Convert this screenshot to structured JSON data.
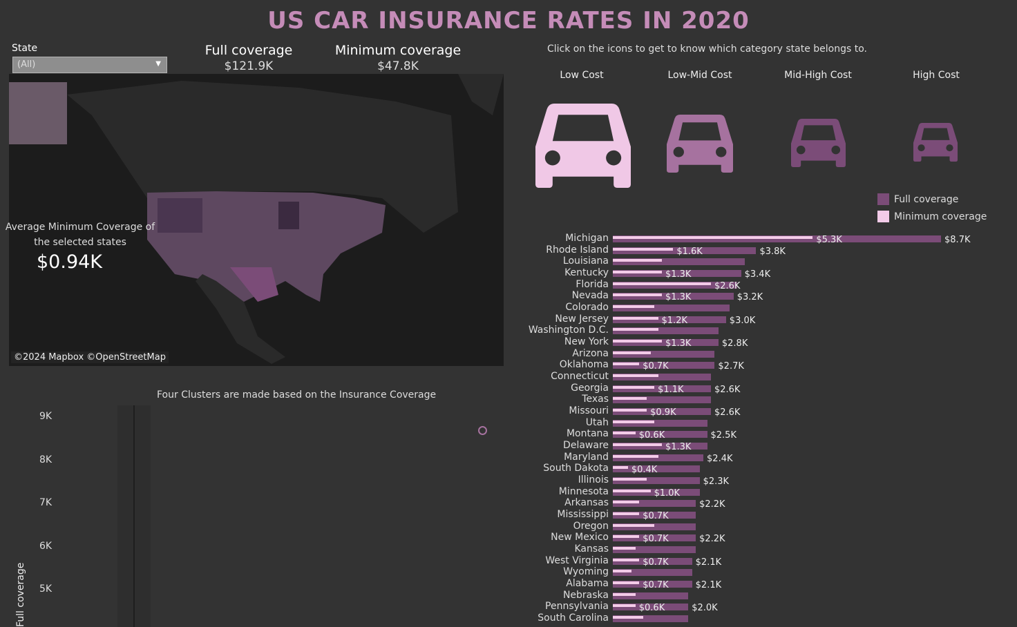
{
  "title": "US CAR INSURANCE RATES IN 2020",
  "filter": {
    "label": "State",
    "value": "(All)"
  },
  "kpis": [
    {
      "label": "Full coverage",
      "value": "$121.9K"
    },
    {
      "label": "Minimum coverage",
      "value": "$47.8K"
    }
  ],
  "map": {
    "credit": "©2024 Mapbox  ©OpenStreetMap",
    "avg_label_1": "Average Minimum Coverage of",
    "avg_label_2": "the selected states",
    "avg_value": "$0.94K"
  },
  "instruction": "Click on the icons to get to know which category state belongs to.",
  "categories": [
    {
      "label": "Low Cost",
      "icon": "car-icon",
      "color": "#f0c8e6"
    },
    {
      "label": "Low-Mid Cost",
      "icon": "car-icon",
      "color": "#a6729f"
    },
    {
      "label": "Mid-High Cost",
      "icon": "car-icon",
      "color": "#7b4c78"
    },
    {
      "label": "High Cost",
      "icon": "car-icon",
      "color": "#7b4c78"
    }
  ],
  "legend": [
    {
      "label": "Full coverage",
      "color": "#7b4c78"
    },
    {
      "label": "Minimum coverage",
      "color": "#f3cbe8"
    }
  ],
  "chart_data": [
    {
      "type": "bar",
      "orientation": "horizontal",
      "series": [
        {
          "name": "Full coverage",
          "color": "#7b4c78"
        },
        {
          "name": "Minimum coverage",
          "color": "#f3cbe8"
        }
      ],
      "rows": [
        {
          "state": "Michigan",
          "full": 8.7,
          "min": 5.3,
          "full_label": "$8.7K",
          "min_label": "$5.3K"
        },
        {
          "state": "Rhode Island",
          "full": 3.8,
          "min": 1.6,
          "full_label": "$3.8K",
          "min_label": "$1.6K"
        },
        {
          "state": "Louisiana",
          "full": 3.5,
          "min": 1.3,
          "full_label": "",
          "min_label": ""
        },
        {
          "state": "Kentucky",
          "full": 3.4,
          "min": 1.3,
          "full_label": "$3.4K",
          "min_label": "$1.3K"
        },
        {
          "state": "Florida",
          "full": 3.3,
          "min": 2.6,
          "full_label": "",
          "min_label": "$2.6K"
        },
        {
          "state": "Nevada",
          "full": 3.2,
          "min": 1.3,
          "full_label": "$3.2K",
          "min_label": "$1.3K"
        },
        {
          "state": "Colorado",
          "full": 3.1,
          "min": 1.1,
          "full_label": "",
          "min_label": ""
        },
        {
          "state": "New Jersey",
          "full": 3.0,
          "min": 1.2,
          "full_label": "$3.0K",
          "min_label": "$1.2K"
        },
        {
          "state": "Washington D.C.",
          "full": 2.8,
          "min": 1.2,
          "full_label": "",
          "min_label": ""
        },
        {
          "state": "New York",
          "full": 2.8,
          "min": 1.3,
          "full_label": "$2.8K",
          "min_label": "$1.3K"
        },
        {
          "state": "Arizona",
          "full": 2.7,
          "min": 1.0,
          "full_label": "",
          "min_label": ""
        },
        {
          "state": "Oklahoma",
          "full": 2.7,
          "min": 0.7,
          "full_label": "$2.7K",
          "min_label": "$0.7K"
        },
        {
          "state": "Connecticut",
          "full": 2.6,
          "min": 1.2,
          "full_label": "",
          "min_label": ""
        },
        {
          "state": "Georgia",
          "full": 2.6,
          "min": 1.1,
          "full_label": "$2.6K",
          "min_label": "$1.1K"
        },
        {
          "state": "Texas",
          "full": 2.6,
          "min": 0.9,
          "full_label": "",
          "min_label": ""
        },
        {
          "state": "Missouri",
          "full": 2.6,
          "min": 0.9,
          "full_label": "$2.6K",
          "min_label": "$0.9K"
        },
        {
          "state": "Utah",
          "full": 2.5,
          "min": 1.1,
          "full_label": "",
          "min_label": ""
        },
        {
          "state": "Montana",
          "full": 2.5,
          "min": 0.6,
          "full_label": "$2.5K",
          "min_label": "$0.6K"
        },
        {
          "state": "Delaware",
          "full": 2.5,
          "min": 1.3,
          "full_label": "",
          "min_label": "$1.3K"
        },
        {
          "state": "Maryland",
          "full": 2.4,
          "min": 1.2,
          "full_label": "$2.4K",
          "min_label": ""
        },
        {
          "state": "South Dakota",
          "full": 2.3,
          "min": 0.4,
          "full_label": "",
          "min_label": "$0.4K"
        },
        {
          "state": "Illinois",
          "full": 2.3,
          "min": 0.9,
          "full_label": "$2.3K",
          "min_label": ""
        },
        {
          "state": "Minnesota",
          "full": 2.3,
          "min": 1.0,
          "full_label": "",
          "min_label": "$1.0K"
        },
        {
          "state": "Arkansas",
          "full": 2.2,
          "min": 0.7,
          "full_label": "$2.2K",
          "min_label": ""
        },
        {
          "state": "Mississippi",
          "full": 2.2,
          "min": 0.7,
          "full_label": "",
          "min_label": "$0.7K"
        },
        {
          "state": "Oregon",
          "full": 2.2,
          "min": 1.1,
          "full_label": "",
          "min_label": ""
        },
        {
          "state": "New Mexico",
          "full": 2.2,
          "min": 0.7,
          "full_label": "$2.2K",
          "min_label": "$0.7K"
        },
        {
          "state": "Kansas",
          "full": 2.2,
          "min": 0.6,
          "full_label": "",
          "min_label": ""
        },
        {
          "state": "West Virginia",
          "full": 2.1,
          "min": 0.7,
          "full_label": "$2.1K",
          "min_label": "$0.7K"
        },
        {
          "state": "Wyoming",
          "full": 2.1,
          "min": 0.5,
          "full_label": "",
          "min_label": ""
        },
        {
          "state": "Alabama",
          "full": 2.1,
          "min": 0.7,
          "full_label": "$2.1K",
          "min_label": "$0.7K"
        },
        {
          "state": "Nebraska",
          "full": 2.0,
          "min": 0.6,
          "full_label": "",
          "min_label": ""
        },
        {
          "state": "Pennsylvania",
          "full": 2.0,
          "min": 0.6,
          "full_label": "$2.0K",
          "min_label": "$0.6K"
        },
        {
          "state": "South Carolina",
          "full": 2.0,
          "min": 0.8,
          "full_label": "",
          "min_label": ""
        }
      ]
    },
    {
      "type": "scatter",
      "title": "Four Clusters are made based on the Insurance Coverage",
      "ylabel": "Full coverage",
      "yticks": [
        "9K",
        "8K",
        "7K",
        "6K",
        "5K"
      ],
      "points": [
        {
          "y": 8.7,
          "color": "#a6729f"
        }
      ]
    }
  ]
}
